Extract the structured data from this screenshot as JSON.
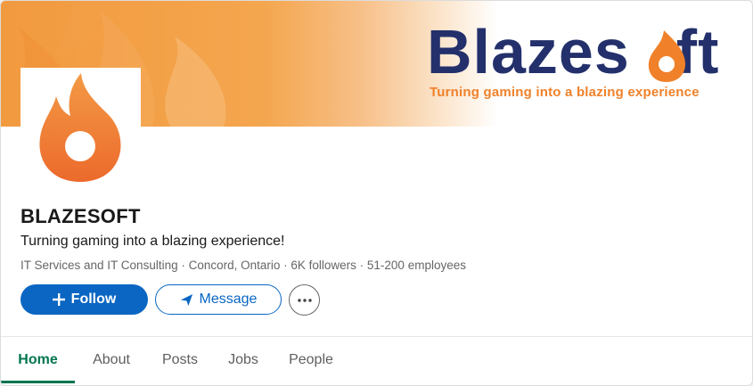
{
  "banner": {
    "brand_name_start": "Blazes",
    "brand_name_end": "ft",
    "brand_tagline": "Turning gaming into a blazing experience",
    "brand_colors": {
      "navy": "#23306b",
      "orange": "#f0812a"
    }
  },
  "company": {
    "name": "BLAZESOFT",
    "tagline": "Turning gaming into a blazing experience!",
    "meta": "IT Services and IT Consulting · Concord, Ontario · 6K followers · 51-200 employees"
  },
  "actions": {
    "follow_label": "Follow",
    "follow_icon": "plus-icon",
    "message_label": "Message",
    "message_icon": "send-icon",
    "more_icon": "more-options-icon"
  },
  "tabs": [
    {
      "label": "Home",
      "active": true
    },
    {
      "label": "About",
      "active": false
    },
    {
      "label": "Posts",
      "active": false
    },
    {
      "label": "Jobs",
      "active": false
    },
    {
      "label": "People",
      "active": false
    }
  ],
  "colors": {
    "primary_blue": "#0a66c2",
    "active_tab_green": "#01754f",
    "muted_text": "#666666"
  }
}
